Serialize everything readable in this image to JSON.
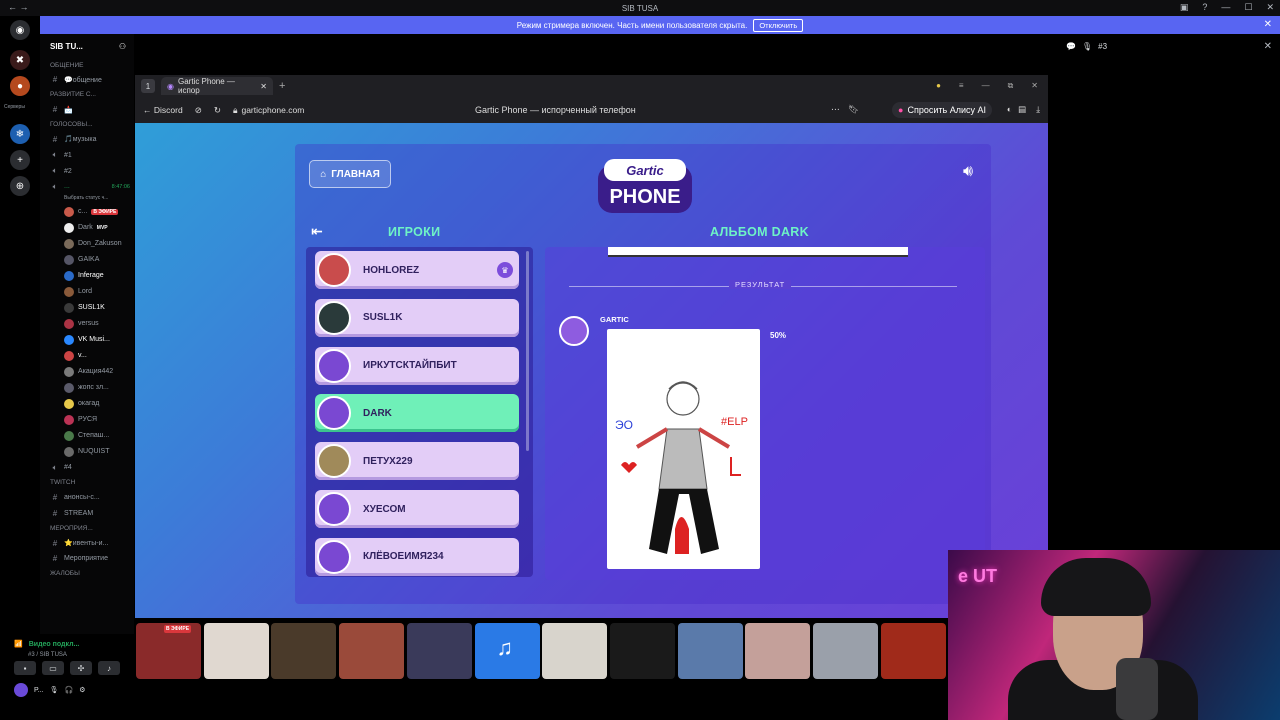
{
  "window": {
    "title": "SIB TUSA"
  },
  "banner": {
    "text": "Режим стримера включен. Часть имени пользователя скрыта.",
    "button": "Отключить"
  },
  "server": {
    "name": "SIB TU...",
    "rail_label": "Серверы"
  },
  "channels": [
    {
      "type": "cat",
      "label": "ОБЩЕНИЕ"
    },
    {
      "type": "text",
      "label": "💬общение"
    },
    {
      "type": "cat",
      "label": "РАЗВИТИЕ С..."
    },
    {
      "type": "text",
      "label": "📩"
    },
    {
      "type": "cat",
      "label": "ГОЛОСОВЫ..."
    },
    {
      "type": "text",
      "label": "🎵музыка"
    },
    {
      "type": "voice",
      "label": "#1"
    },
    {
      "type": "voice",
      "label": "#2"
    },
    {
      "type": "voice-active",
      "label": "...",
      "time": "8:47:06",
      "status": "Выбрать статус ч..."
    }
  ],
  "members": [
    {
      "name": "с...",
      "badge": "В ЭФИРЕ",
      "color": "#c85a4a"
    },
    {
      "name": "Dark",
      "badge": "MVP",
      "color": "#eeeeee"
    },
    {
      "name": "Don_Zakuson",
      "color": "#7a6a5a"
    },
    {
      "name": "GAIKA",
      "color": "#556"
    },
    {
      "name": "Inferage",
      "color": "#2a6ac8",
      "bright": true
    },
    {
      "name": "Lord",
      "color": "#8a5a3a"
    },
    {
      "name": "SUSL1K",
      "color": "#3a3a3a",
      "bright": true
    },
    {
      "name": "versus",
      "color": "#aa3344"
    },
    {
      "name": "VK Musi...",
      "color": "#2a88ff",
      "bright": true
    },
    {
      "name": "v...",
      "color": "#cc4444",
      "bright": true
    },
    {
      "name": "Акация442",
      "color": "#7a7a7a"
    },
    {
      "name": "жопс зл...",
      "color": "#5a5a6a"
    },
    {
      "name": "окагад",
      "color": "#e6c84a"
    },
    {
      "name": "РУСЯ",
      "color": "#bb3355"
    },
    {
      "name": "Степаш...",
      "color": "#4a7a4a"
    },
    {
      "name": "NUQUIST",
      "color": "#6a6a6a"
    }
  ],
  "channels_bottom": [
    {
      "type": "voice",
      "label": "#4"
    },
    {
      "type": "cat",
      "label": "TWITCH"
    },
    {
      "type": "text",
      "label": "анонсы-с..."
    },
    {
      "type": "text",
      "label": "STREAM"
    },
    {
      "type": "cat",
      "label": "МЕРОПРИЯ..."
    },
    {
      "type": "text",
      "label": "⭐ивенты-и..."
    },
    {
      "type": "text",
      "label": "Мероприятие"
    },
    {
      "type": "cat",
      "label": "ЖАЛОБЫ"
    }
  ],
  "voice_panel": {
    "status": "Видео подкл...",
    "sub": "#3 / SIB TUSA",
    "user": "P..."
  },
  "browser": {
    "tab_title": "Gartic Phone — испор",
    "back_label": "Discord",
    "url": "garticphone.com",
    "page_title": "Gartic Phone — испорченный телефон",
    "alisa": "Спросить Алису AI"
  },
  "game": {
    "home_button": "ГЛАВНАЯ",
    "logo_top": "Gartic",
    "logo_main": "PHONE",
    "players_title": "ИГРОКИ",
    "album_title": "АЛЬБОМ DARK",
    "players": [
      {
        "name": "HOHLOREZ",
        "host": true,
        "avatar": "#c94c4c"
      },
      {
        "name": "SUSL1K",
        "host": false,
        "avatar": "#2a3a3a"
      },
      {
        "name": "ИРКУТСКТАЙПБИТ",
        "host": false,
        "avatar": "#7a48d2"
      },
      {
        "name": "DARK",
        "host": false,
        "active": true,
        "avatar": "#7a48d2"
      },
      {
        "name": "ПЕТУХ229",
        "host": false,
        "avatar": "#a08a5a"
      },
      {
        "name": "ХУЕСОМ",
        "host": false,
        "avatar": "#7a48d2"
      },
      {
        "name": "КЛЁВОЕИМЯ234",
        "host": false,
        "avatar": "#7a48d2"
      }
    ],
    "result_label": "РЕЗУЛЬТАТ",
    "bot_name": "GARTIC",
    "percent": "50%",
    "drawing_texts": {
      "left": "ЭО",
      "help": "#ELP"
    }
  },
  "right_panel": {
    "channel": "#3"
  },
  "call_tiles": [
    {
      "color": "#8a2a2a",
      "live": "В ЭФИРЕ"
    },
    {
      "color": "#e0d8d0"
    },
    {
      "color": "#4a3a2a"
    },
    {
      "color": "#9a4a3a"
    },
    {
      "color": "#3a3a5a"
    },
    {
      "color": "#2a7ae6",
      "music": true
    },
    {
      "color": "#d8d4cc"
    },
    {
      "color": "#1a1a1a"
    },
    {
      "color": "#5a7aaa"
    },
    {
      "color": "#c4a09a"
    },
    {
      "color": "#9aa0aa"
    },
    {
      "color": "#a02a1a"
    }
  ],
  "webcam": {
    "neon": "e UT"
  }
}
